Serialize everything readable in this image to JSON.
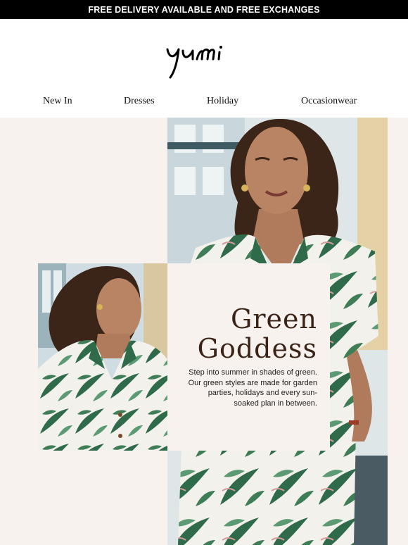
{
  "banner": {
    "text": "FREE DELIVERY AVAILABLE AND FREE EXCHANGES"
  },
  "brand": {
    "logo_text": "Yumi"
  },
  "nav": {
    "items": [
      {
        "label": "New In"
      },
      {
        "label": "Dresses"
      },
      {
        "label": "Holiday"
      },
      {
        "label": "Occasionwear"
      }
    ]
  },
  "hero": {
    "headline_line1": "Green",
    "headline_line2": "Goddess",
    "body_line1": "Step into summer in shades of green.",
    "body_line2": "Our green styles are made for garden",
    "body_line3": "parties, holidays and every sun-",
    "body_line4": "soaked plan in between."
  },
  "colors": {
    "banner_bg": "#000000",
    "hero_bg": "#f8f2ee",
    "headline": "#3a2418",
    "leaf_green": "#2f6b4a"
  }
}
